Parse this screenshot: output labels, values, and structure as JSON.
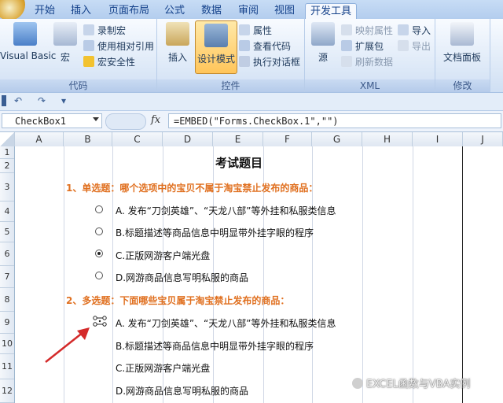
{
  "ribbon": {
    "tabs": [
      "开始",
      "插入",
      "页面布局",
      "公式",
      "数据",
      "审阅",
      "视图",
      "开发工具"
    ],
    "active_tab": "开发工具",
    "groups": {
      "code": {
        "label": "代码",
        "visual_basic": "Visual Basic",
        "macros": "宏",
        "record_macro": "录制宏",
        "relative_ref": "使用相对引用",
        "macro_security": "宏安全性"
      },
      "controls": {
        "label": "控件",
        "insert": "插入",
        "design_mode": "设计模式",
        "properties": "属性",
        "view_code": "查看代码",
        "run_dialog": "执行对话框"
      },
      "xml": {
        "label": "XML",
        "source": "源",
        "map_properties": "映射属性",
        "expansion_packs": "扩展包",
        "refresh_data": "刷新数据",
        "import": "导入",
        "export": "导出"
      },
      "modify": {
        "label": "修改",
        "document_panel": "文档面板"
      }
    }
  },
  "formula_bar": {
    "name_box": "CheckBox1",
    "fx": "fx",
    "formula": "=EMBED(\"Forms.CheckBox.1\",\"\")"
  },
  "sheet": {
    "columns": [
      "A",
      "B",
      "C",
      "D",
      "E",
      "F",
      "G",
      "H",
      "I",
      "J"
    ],
    "rows": [
      "1",
      "2",
      "3",
      "4",
      "5",
      "6",
      "7",
      "8",
      "9",
      "10",
      "11",
      "12"
    ],
    "title": "考试题目",
    "q1": {
      "heading": "1、单选题：哪个选项中的宝贝不属于淘宝禁止发布的商品：",
      "options": [
        "A. 发布“刀剑英雄”、“天龙八部”等外挂和私服类信息",
        "B.标题描述等商品信息中明显带外挂字眼的程序",
        "C.正版网游客户端光盘",
        "D.网游商品信息写明私服的商品"
      ],
      "selected_index": 2
    },
    "q2": {
      "heading": "2、多选题：下面哪些宝贝属于淘宝禁止发布的商品：",
      "options": [
        "A. 发布“刀剑英雄”、“天龙八部”等外挂和私服类信息",
        "B.标题描述等商品信息中明显带外挂字眼的程序",
        "C.正版网游客户端光盘",
        "D.网游商品信息写明私服的商品"
      ]
    }
  },
  "watermark": "EXCEL函数与VBA实例",
  "colors": {
    "question_heading": "#e07020",
    "arrow": "#d42a2a",
    "active_button": "#ffc55a"
  }
}
